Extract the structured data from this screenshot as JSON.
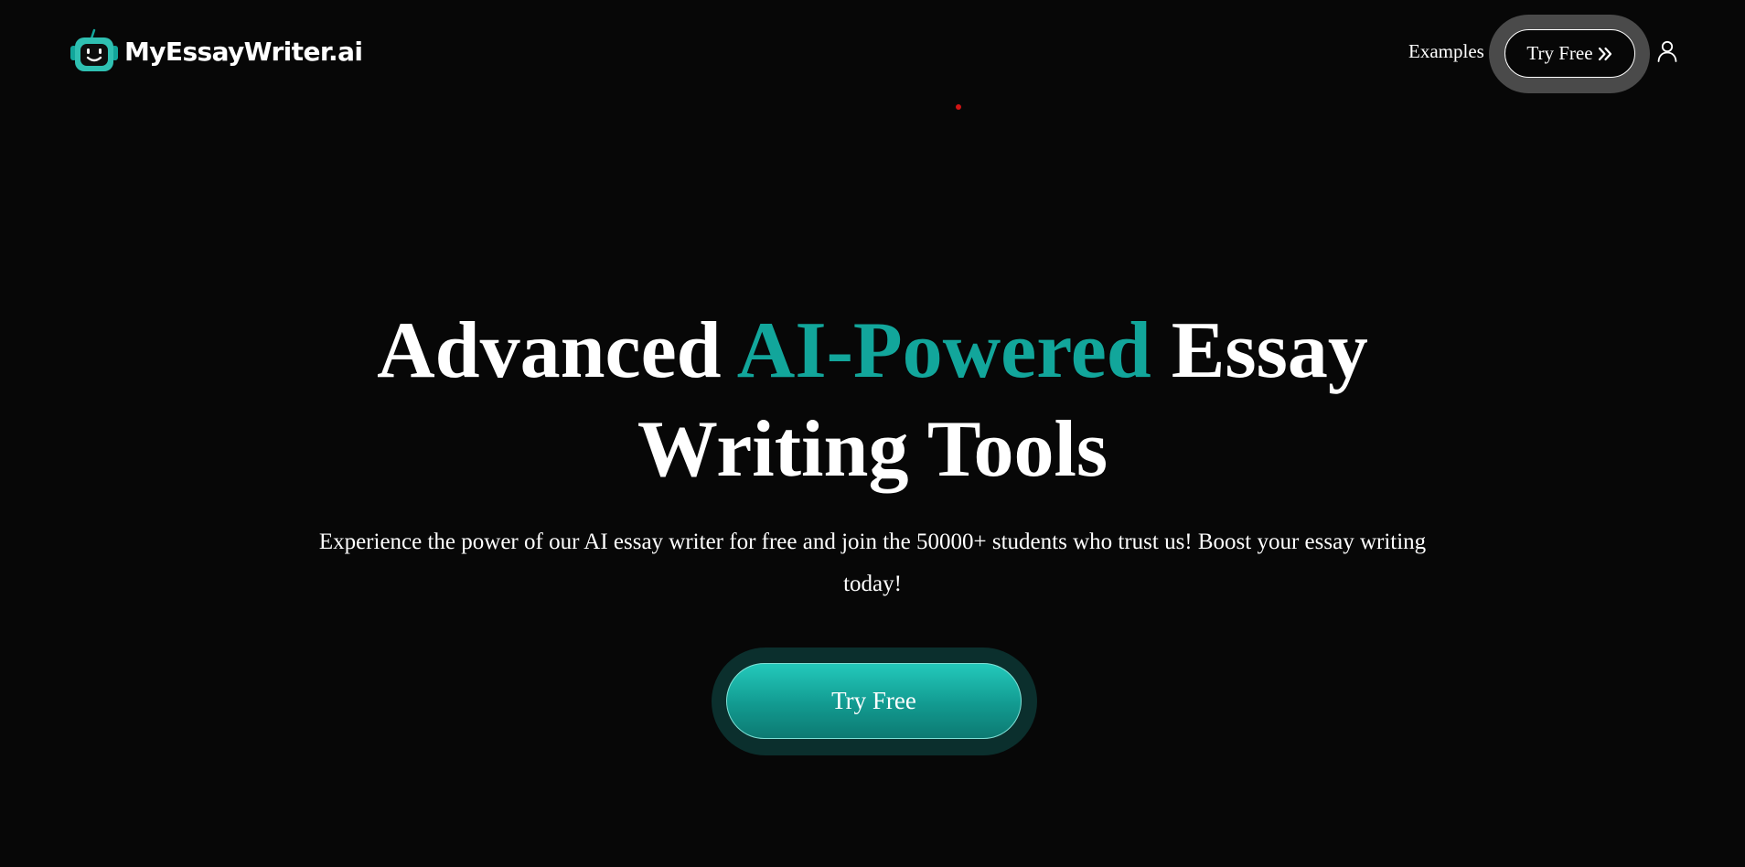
{
  "header": {
    "brand": "MyEssayWriter.ai",
    "logo_icon": "robot-head-logo",
    "nav": {
      "examples_label": "Examples",
      "try_free_label": "Try Free",
      "try_free_icon": "double-chevron-right-icon",
      "account_icon": "user-icon"
    }
  },
  "hero": {
    "title_before": "Advanced",
    "title_accent": "AI-Powered",
    "title_after_line1": "Essay",
    "title_line2": "Writing Tools",
    "subtitle": "Experience the power of our AI essay writer for free and join the 50000+ students who trust us! Boost your essay writing today!",
    "cta_label": "Try Free"
  },
  "colors": {
    "background": "#070707",
    "accent": "#12a69b",
    "text": "#ffffff",
    "nav_halo": "#4a4a4a",
    "cta_halo": "#0b2f2d"
  }
}
